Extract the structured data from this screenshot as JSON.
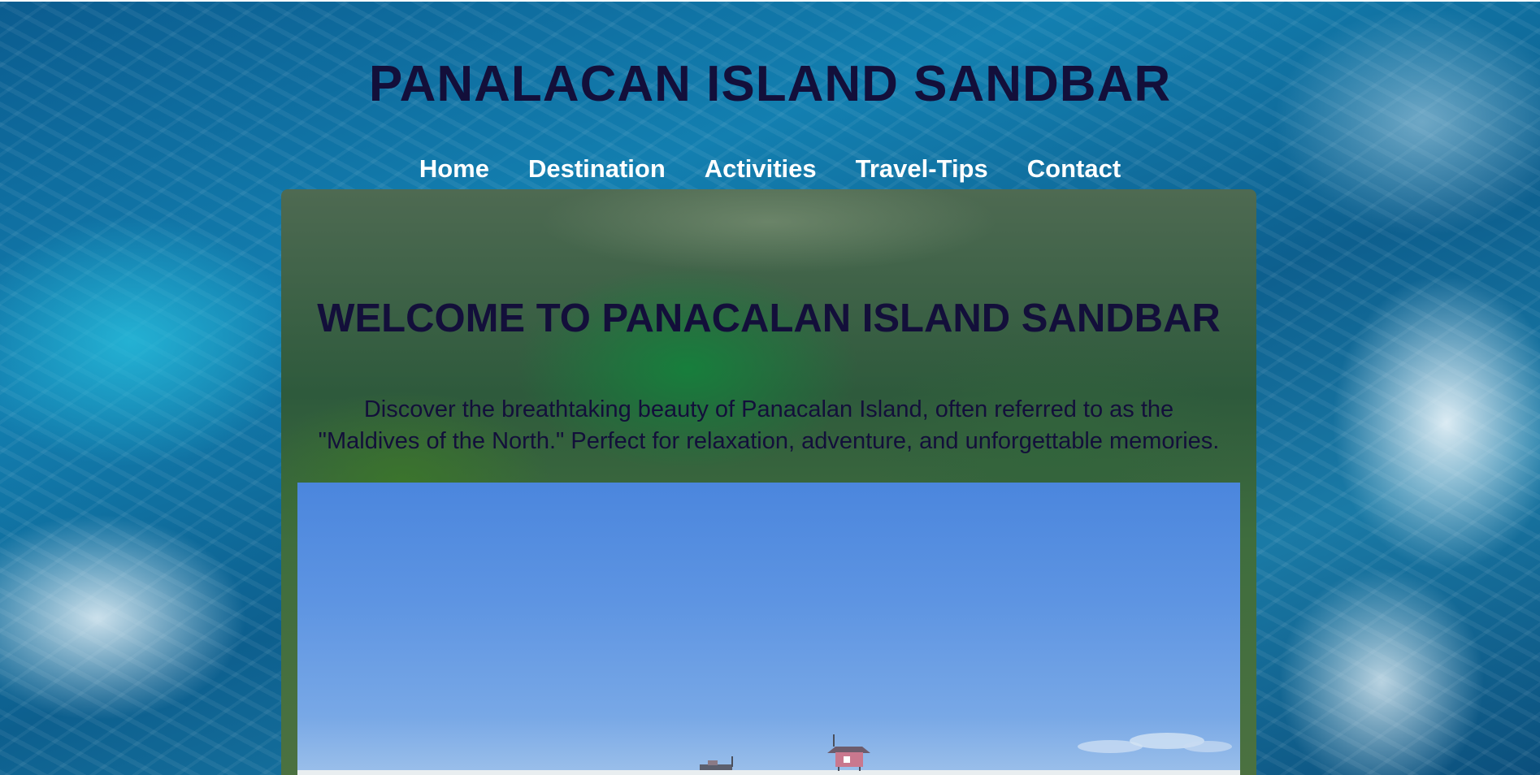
{
  "header": {
    "title": "PANALACAN ISLAND SANDBAR"
  },
  "nav": {
    "items": [
      {
        "label": "Home"
      },
      {
        "label": "Destination"
      },
      {
        "label": "Activities"
      },
      {
        "label": "Travel-Tips"
      },
      {
        "label": "Contact"
      }
    ]
  },
  "main": {
    "heading": "WELCOME TO PANACALAN ISLAND SANDBAR",
    "intro_line1": "Discover the breathtaking beauty of Panacalan Island, often referred to as the",
    "intro_line2": "\"Maldives of the North.\" Perfect for relaxation, adventure, and unforgettable memories."
  },
  "colors": {
    "title_text": "#130f3a",
    "nav_text": "#ffffff",
    "ocean_background": "#0d5f8e",
    "content_panel": "#3f6d3e",
    "hero_sky": "#5d94e2"
  }
}
